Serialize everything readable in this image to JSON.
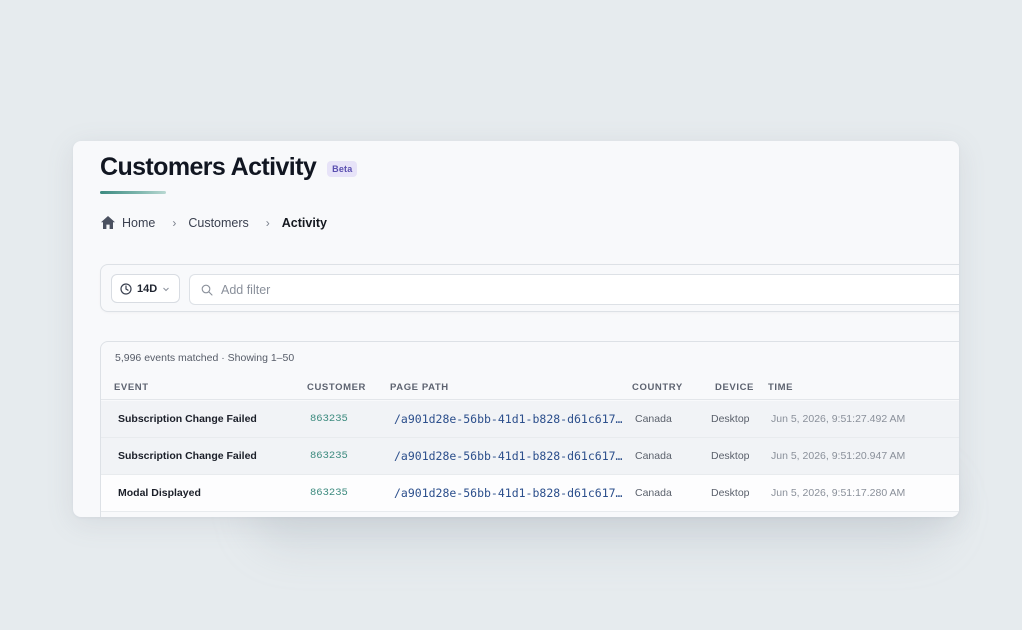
{
  "header": {
    "title": "Customers Activity",
    "badge": "Beta"
  },
  "breadcrumb": {
    "items": [
      "Home",
      "Customers",
      "Activity"
    ]
  },
  "filters": {
    "range_label": "14D",
    "search_placeholder": "Add filter"
  },
  "table": {
    "summary": "5,996 events matched · Showing 1–50",
    "columns": [
      "EVENT",
      "CUSTOMER",
      "PAGE PATH",
      "COUNTRY",
      "DEVICE",
      "TIME"
    ],
    "rows": [
      {
        "event": "Subscription Change Failed",
        "customer": "863235",
        "path": "/a901d28e-56bb-41d1-b828-d61c617…",
        "country": "Canada",
        "device": "Desktop",
        "time": "Jun 5, 2026, 9:51:27.492 AM"
      },
      {
        "event": "Subscription Change Failed",
        "customer": "863235",
        "path": "/a901d28e-56bb-41d1-b828-d61c617…",
        "country": "Canada",
        "device": "Desktop",
        "time": "Jun 5, 2026, 9:51:20.947 AM"
      },
      {
        "event": "Modal Displayed",
        "customer": "863235",
        "path": "/a901d28e-56bb-41d1-b828-d61c617…",
        "country": "Canada",
        "device": "Desktop",
        "time": "Jun 5, 2026, 9:51:17.280 AM"
      }
    ]
  },
  "colors": {
    "background": "#e6ebee",
    "card": "#f8f9fb",
    "customer_id": "#3d8b7f",
    "page_path": "#2c4f8c",
    "badge_bg": "#e7e3f8",
    "badge_text": "#5a4fb0"
  },
  "icons": {
    "home": "home-icon",
    "separator": "chevron-right-icon",
    "clock": "clock-icon",
    "dropdown": "chevron-down-icon",
    "search": "search-icon"
  }
}
